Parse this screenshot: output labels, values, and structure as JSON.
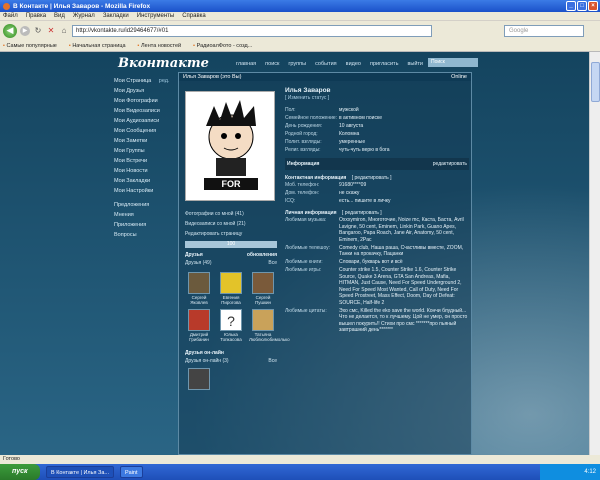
{
  "window": {
    "title": "В Контакте | Илья Заваров - Mozilla Firefox"
  },
  "menu": [
    "Файл",
    "Правка",
    "Вид",
    "Журнал",
    "Закладки",
    "Инструменты",
    "Справка"
  ],
  "nav": {
    "url": "http://vkontakte.ru/id29464677/#01",
    "search_placeholder": "Google"
  },
  "bookmarks": [
    "Самые популярные",
    "Начальная страница",
    "Лента новостей",
    "РадиоалФото - созд..."
  ],
  "site": {
    "logo": "Вконтакте",
    "topnav": [
      "главная",
      "поиск",
      "группы",
      "события",
      "видео",
      "пригласить",
      "выйти"
    ],
    "search_placeholder": "Поиск"
  },
  "leftmenu": [
    "Мои Страница",
    "Мои Друзья",
    "Мои Фотографии",
    "Мои Видеозаписи",
    "Мои Аудиозаписи",
    "Мои Сообщения",
    "Мои Заметки",
    "Мои Группы",
    "Мои Встречи",
    "Мои Новости",
    "Мои Закладки",
    "Мои Настройки"
  ],
  "leftmenu_edit": "ред.",
  "leftmenu2": [
    "Предложения",
    "Мнения",
    "Приложения",
    "Вопросы"
  ],
  "profile": {
    "header": "Илья Заваров (это Вы)",
    "online": "Online",
    "name": "Илья Заваров",
    "status": "[ Изменить статус ]",
    "info": [
      {
        "k": "Пол:",
        "v": "мужской"
      },
      {
        "k": "Семейное положение:",
        "v": "в активном поиске"
      },
      {
        "k": "День рождения:",
        "v": "10 августа"
      },
      {
        "k": "Родной город:",
        "v": "Коломна"
      },
      {
        "k": "Полит. взгляды:",
        "v": "умеренные"
      },
      {
        "k": "Религ. взгляды:",
        "v": "чуть-чуть верю в бога"
      }
    ],
    "info_block": "Информация",
    "info_edit": "редактировать",
    "contact_title": "Контактная информация",
    "contact_edit": "[ редактировать ]",
    "contacts": [
      {
        "k": "Моб. телефон:",
        "v": "91680****09"
      },
      {
        "k": "Дом. телефон:",
        "v": "не скажу"
      },
      {
        "k": "ICQ:",
        "v": "есть... пишите в личку"
      }
    ],
    "personal_title": "Личная информация",
    "personal_edit": "[ редактировать ]",
    "personal": [
      {
        "k": "Любимая музыка:",
        "v": "Oxxxymiron, Многоточие, Noize mc, Каста, Баста, Avril Lavigne, 50 cent, Eminem, Linkin Park, Guano Apes, Bangaroo, Papa Roach, Jane Air, Anatomy, 50 cent, Eminem, 2Pac"
      },
      {
        "k": "Любимые телешоу:",
        "v": "Comedy club, Наша раша, Счастливы вместе, ZOOM, Танки на прокачку, Пацанки"
      },
      {
        "k": "Любимые книги:",
        "v": "Словари, букварь вот и всё"
      },
      {
        "k": "Любимые игры:",
        "v": "Counter strike 1.5, Counter Strike 1.6, Counter Strike Source, Quake 3 Arena, GTA San Andreas, Mafia, HITMAN, Just Cause, Need For Speed Underground 2, Need For Speed Most Wanted, Call of Duty, Need For Speed Prostreet, Mass Effect, Doom, Day of Defeat: SOURCE, Half-life 2"
      },
      {
        "k": "Любимые цитаты:",
        "v": "Эхо смс, Killed the eko save the world. Кончи блудный... Что не делается, то к лучшему. Цой не умер, он просто вышел покурить!! Стихи про смс *******про пьяный завтрашний день*******"
      }
    ],
    "left": {
      "photos_with": "Фотографии со мной (41)",
      "videos_with": "Видеозаписи со мной (21)",
      "edit_page": "Редактировать страницу",
      "rating_bar": "100",
      "friends_title": "Друзья",
      "friends_updates": "обновления",
      "friends_count": "Друзья (49)",
      "all": "Все",
      "friends": [
        {
          "name": "Сергей Яковлев",
          "color": "#6b5a3d"
        },
        {
          "name": "Евгения Пирогова",
          "color": "#e3c329"
        },
        {
          "name": "Сергей Пушкин",
          "color": "#7a5a3a"
        },
        {
          "name": "Дмитрий Грибанин",
          "color": "#b83a2a"
        },
        {
          "name": "Юлька Топкасова",
          "color": "#ffffff"
        },
        {
          "name": "Татьяна Люблюлюбимолько",
          "color": "#c9a25a"
        }
      ],
      "online_title": "Друзья он-лайн",
      "online_count": "Друзья он-лайн (3)",
      "online_all": "Все"
    }
  },
  "status_bar": "Готово",
  "taskbar": {
    "start": "пуск",
    "tasks": [
      "В Контакте | Илья За...",
      "Paint"
    ],
    "clock": "4:12"
  }
}
